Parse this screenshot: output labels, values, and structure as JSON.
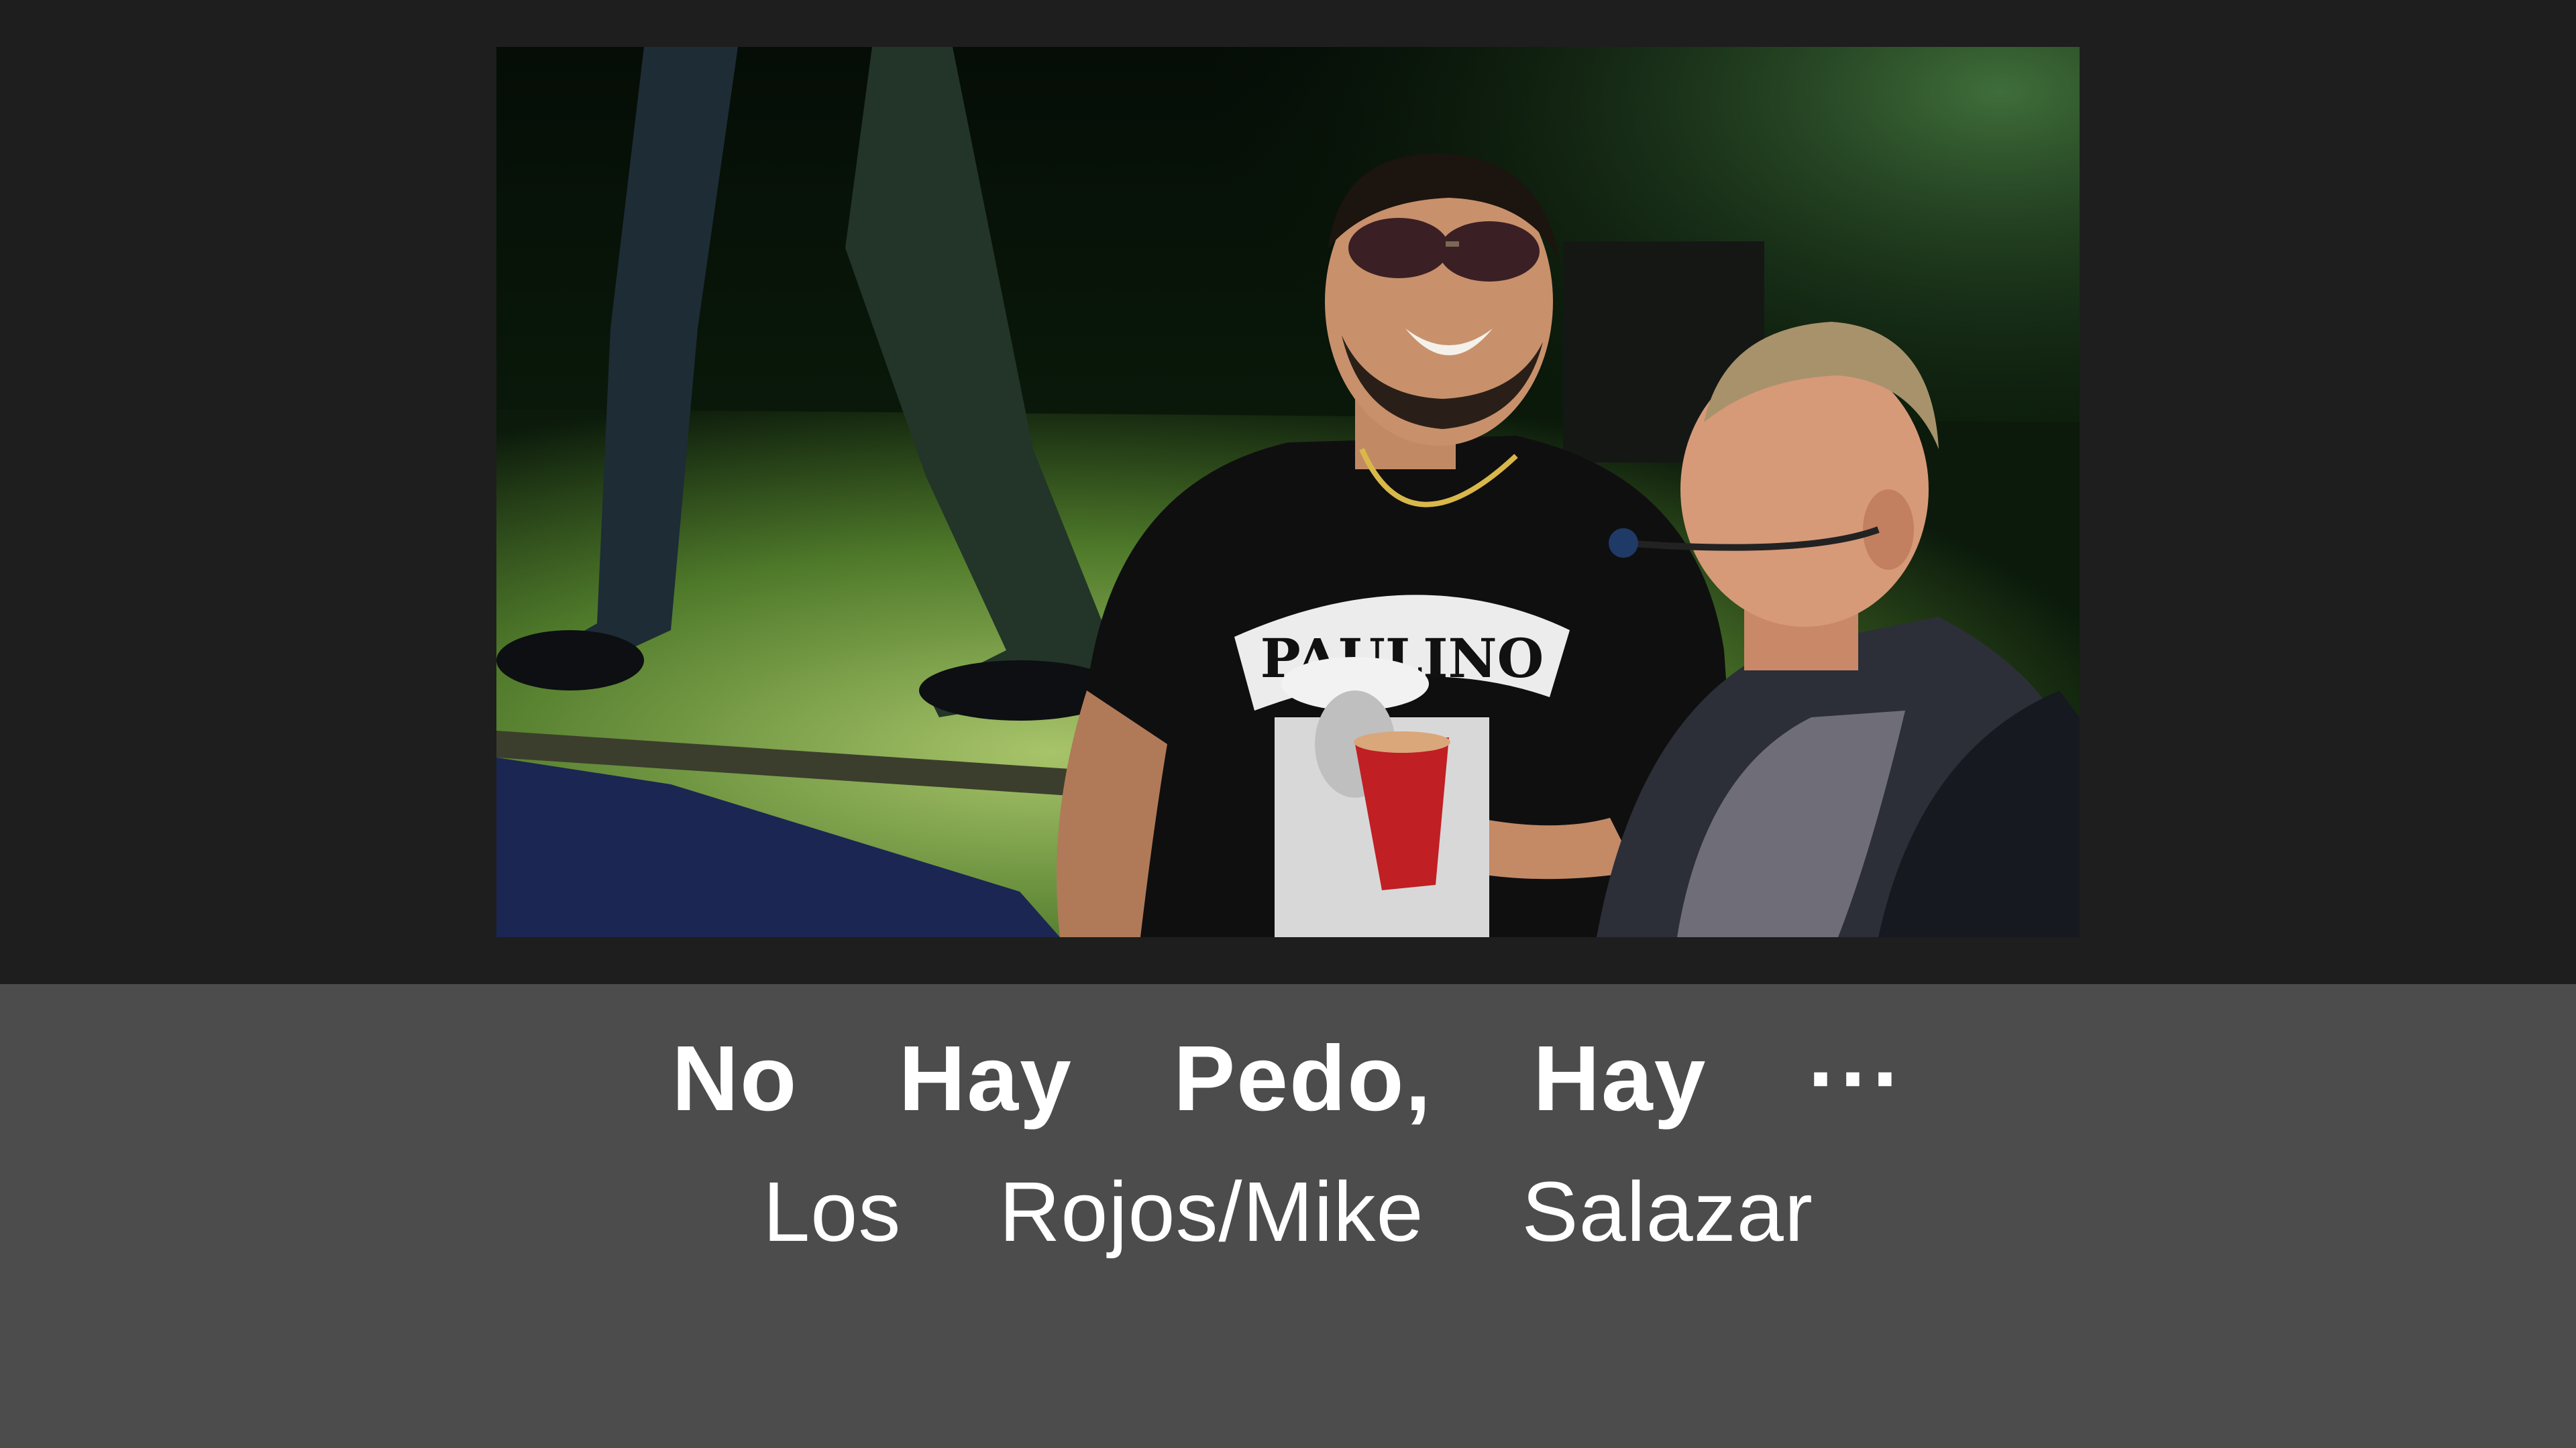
{
  "player": {
    "video": {
      "scene_description_icon": "concert-video-frame-icon",
      "shirt_text": "PAULINO"
    },
    "now_playing": {
      "title": "No Hay Pedo, Hay ···",
      "artist": "Los Rojos/Mike Salazar"
    }
  },
  "colors": {
    "background": "#1e1e1e",
    "info_panel": "#4c4c4c",
    "text": "#ffffff"
  }
}
